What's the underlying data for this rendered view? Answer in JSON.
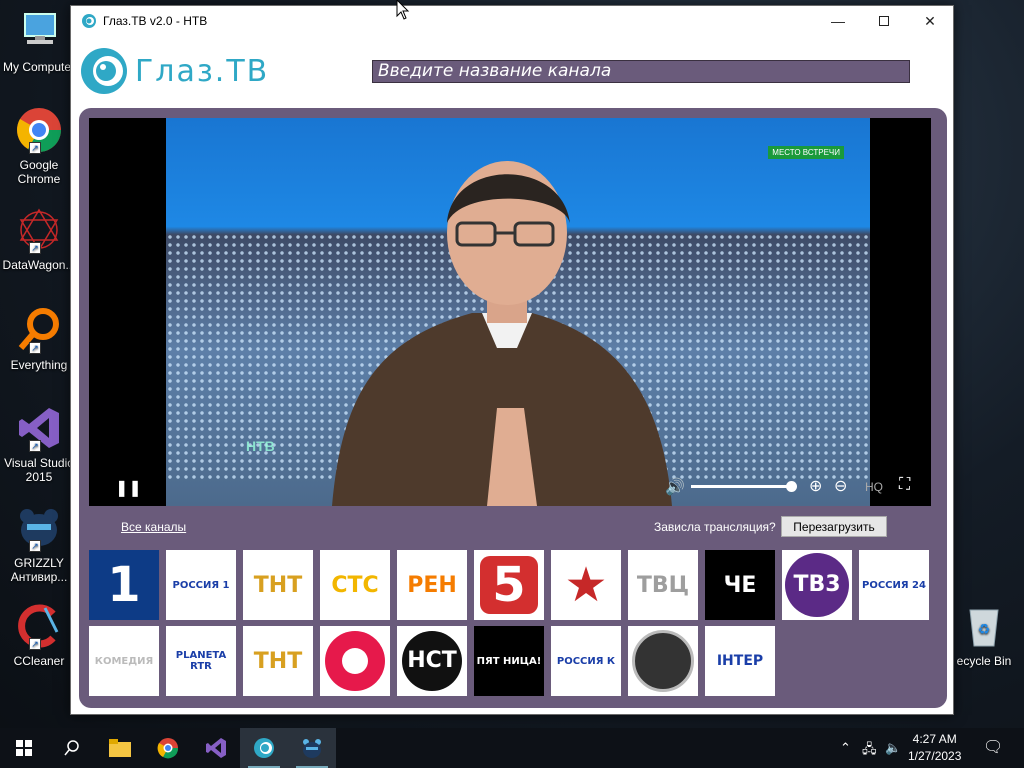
{
  "desktop": {
    "icons": [
      {
        "label": "My Computer"
      },
      {
        "label": "Google Chrome"
      },
      {
        "label": "DataWagon..."
      },
      {
        "label": "Everything"
      },
      {
        "label": "Visual Studio 2015"
      },
      {
        "label": "GRIZZLY Антивир..."
      },
      {
        "label": "CCleaner"
      }
    ],
    "recycle_label": "ecycle Bin"
  },
  "window": {
    "title": "Глаз.ТВ v2.0 - НТВ",
    "min_icon": "minimize-icon",
    "max_icon": "maximize-icon",
    "close_icon": "close-icon"
  },
  "app": {
    "logo_text": "Глаз.ТВ",
    "search_placeholder": "Введите название канала",
    "player": {
      "overlay_badge": "МЕСТО ВСТРЕЧИ",
      "watermark": "НТВ",
      "volume": 1.0,
      "hq_label": "HQ"
    },
    "all_channels": "Все каналы",
    "stuck_question": "Зависла трансляция?",
    "reload_button": "Перезагрузить",
    "channels": [
      {
        "name": "Первый канал",
        "text": "1",
        "bg": "#0d3b86",
        "fg": "#ffffff"
      },
      {
        "name": "Россия 1",
        "text": "РОССИЯ 1",
        "bg": "#ffffff",
        "fg": "#1a3ea8"
      },
      {
        "name": "ТНТ",
        "text": "ТНТ",
        "bg": "#ffffff",
        "fg": "#d8a020"
      },
      {
        "name": "СТС",
        "text": "СТС",
        "bg": "#ffffff",
        "fg": "#f2b600"
      },
      {
        "name": "РЕН",
        "text": "РЕН",
        "bg": "#ffffff",
        "fg": "#f57c00"
      },
      {
        "name": "Пятый канал",
        "text": "5",
        "bg": "#ffffff",
        "fg": "#d32f2f"
      },
      {
        "name": "Звезда",
        "text": "★",
        "bg": "#ffffff",
        "fg": "#c62828"
      },
      {
        "name": "ТВЦ",
        "text": "ТВЦ",
        "bg": "#ffffff",
        "fg": "#9e9e9e"
      },
      {
        "name": "Че",
        "text": "ЧЕ",
        "bg": "#000000",
        "fg": "#ffffff"
      },
      {
        "name": "ТВ3",
        "text": "ТВ3",
        "bg": "#ffffff",
        "fg": "#5b2a86"
      },
      {
        "name": "Россия 24",
        "text": "РОССИЯ 24",
        "bg": "#ffffff",
        "fg": "#1a3ea8"
      },
      {
        "name": "Комедия",
        "text": "КОМЕДИЯ",
        "bg": "#ffffff",
        "fg": "#bbbbbb"
      },
      {
        "name": "Planeta RTR",
        "text": "PLANETA RTR",
        "bg": "#ffffff",
        "fg": "#1a3ea8"
      },
      {
        "name": "ТНТ Comedy",
        "text": "ТНТ",
        "bg": "#ffffff",
        "fg": "#d8a020"
      },
      {
        "name": "Домашний",
        "text": "",
        "bg": "#ffffff",
        "fg": "#e6194b"
      },
      {
        "name": "НСТ",
        "text": "НСТ",
        "bg": "#ffffff",
        "fg": "#111111"
      },
      {
        "name": "Пятница",
        "text": "ПЯТ НИЦА!",
        "bg": "#000000",
        "fg": "#ffffff"
      },
      {
        "name": "Россия К",
        "text": "РОССИЯ К",
        "bg": "#ffffff",
        "fg": "#1a3ea8"
      },
      {
        "name": "Страна",
        "text": "",
        "bg": "#ffffff",
        "fg": "#444444"
      },
      {
        "name": "Интер",
        "text": "ІНТЕР",
        "bg": "#ffffff",
        "fg": "#1a3ea8"
      }
    ]
  },
  "taskbar": {
    "time": "4:27 AM",
    "date": "1/27/2023"
  }
}
